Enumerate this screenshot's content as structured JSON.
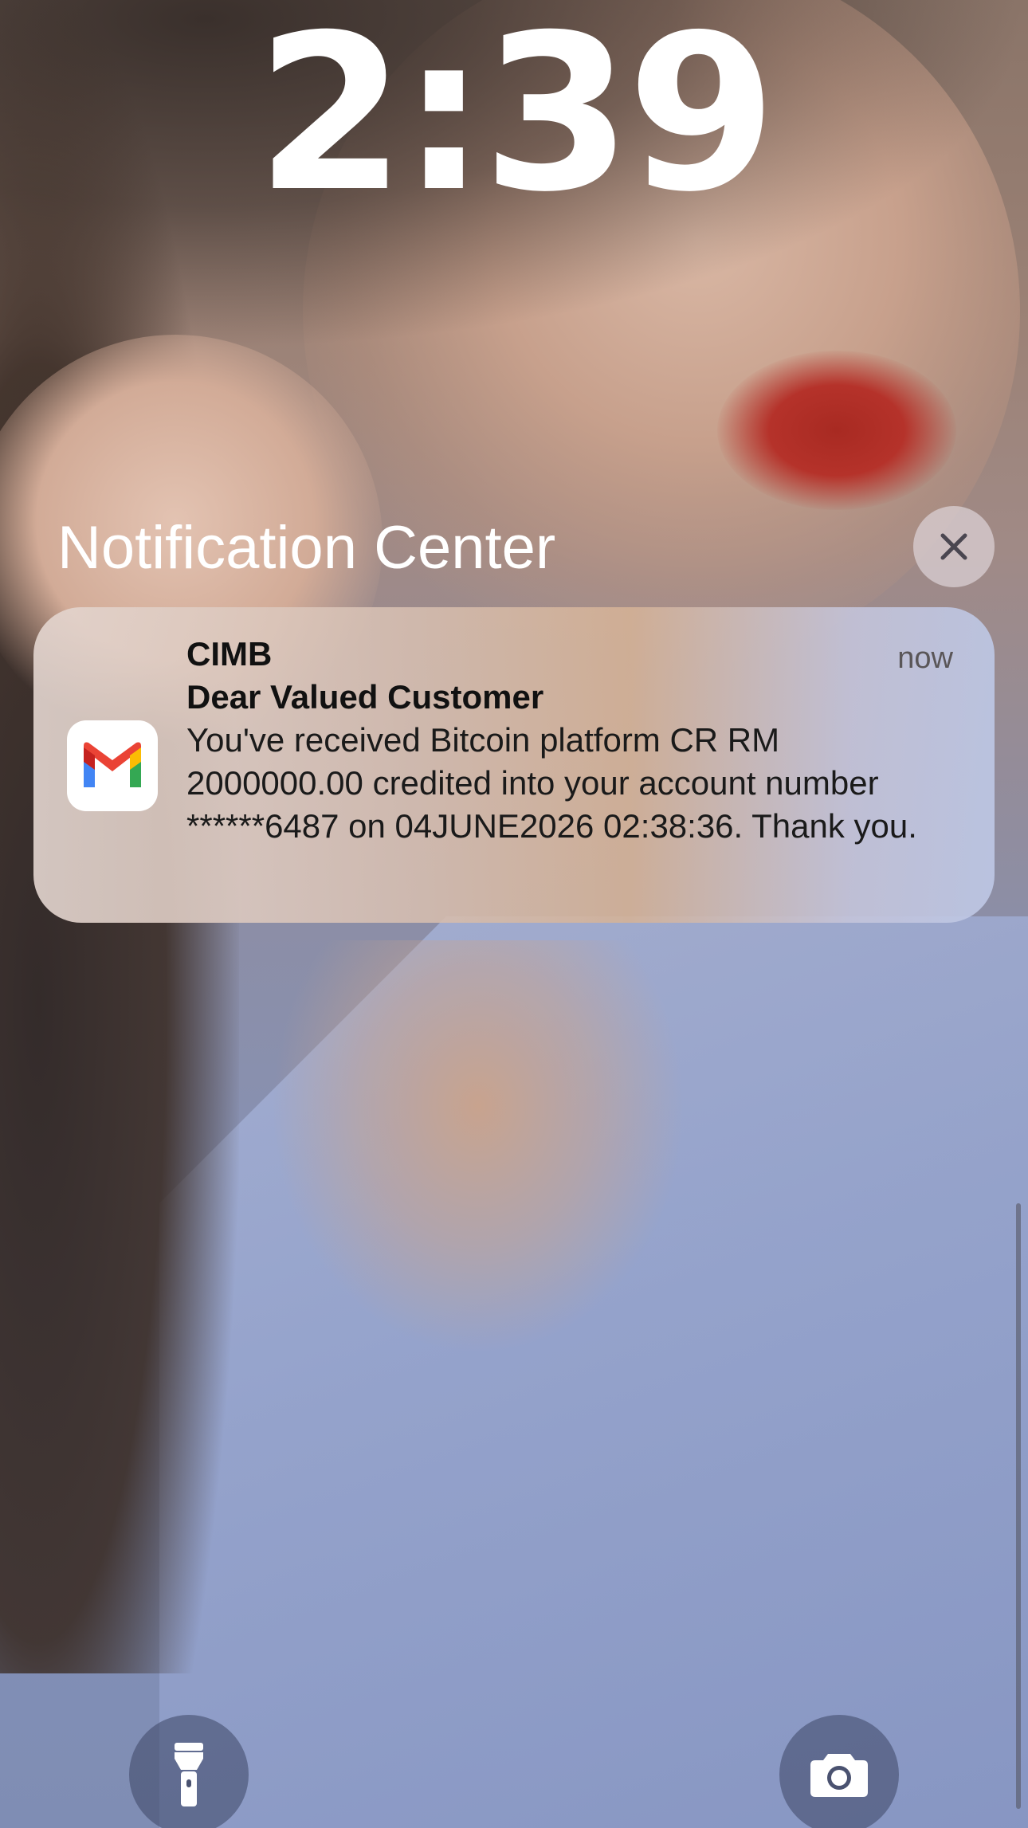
{
  "lockscreen": {
    "time": "2:39"
  },
  "notification_center": {
    "title": "Notification Center",
    "close_icon": "close-icon"
  },
  "notification": {
    "app_icon": "gmail-icon",
    "sender": "CIMB",
    "subject": "Dear Valued Customer",
    "body": "You've received Bitcoin platform CR RM 2000000.00 credited into your account number ******6487 on 04JUNE2026 02:38:36. Thank you.",
    "time": "now"
  },
  "quick_actions": {
    "left_icon": "flashlight-icon",
    "right_icon": "camera-icon"
  }
}
